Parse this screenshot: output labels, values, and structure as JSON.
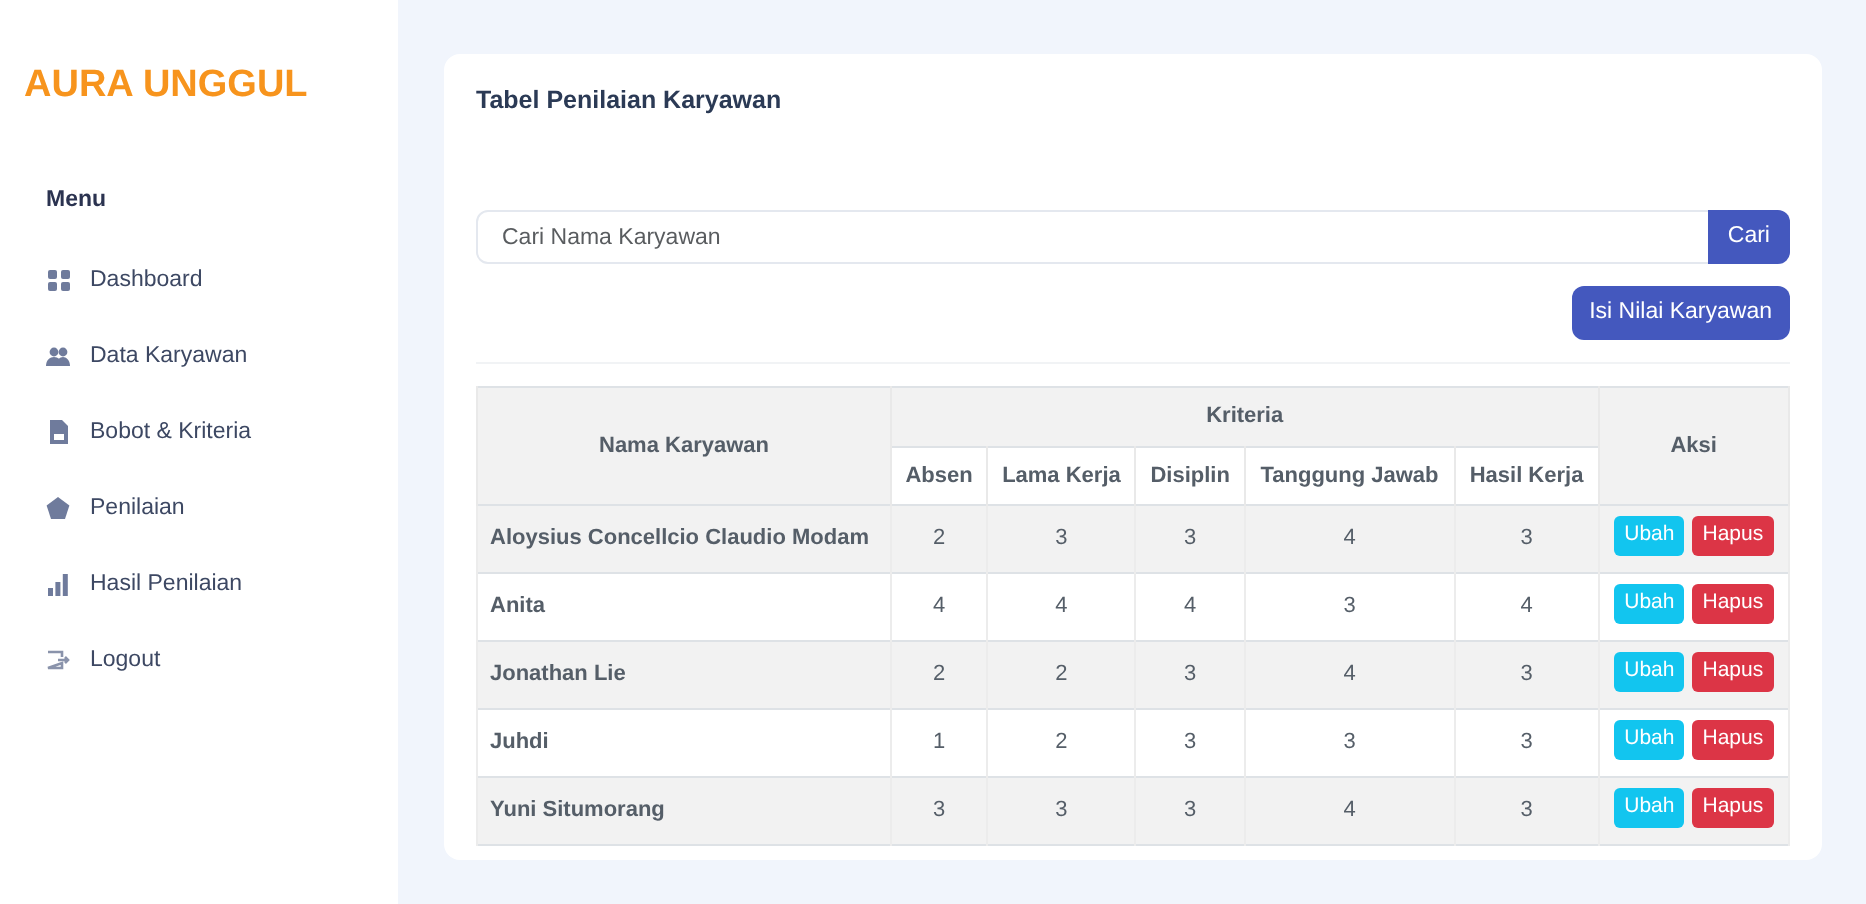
{
  "brand": "AURA UNGGUL",
  "menu": {
    "heading": "Menu",
    "items": [
      {
        "label": "Dashboard"
      },
      {
        "label": "Data Karyawan"
      },
      {
        "label": "Bobot & Kriteria"
      },
      {
        "label": "Penilaian"
      },
      {
        "label": "Hasil Penilaian"
      },
      {
        "label": "Logout"
      }
    ]
  },
  "card": {
    "title": "Tabel Penilaian Karyawan",
    "search": {
      "placeholder": "Cari Nama Karyawan",
      "button": "Cari"
    },
    "add_button": "Isi Nilai Karyawan",
    "table": {
      "name_column": "Nama Karyawan",
      "group_column": "Kriteria",
      "criteria": [
        "Absen",
        "Lama Kerja",
        "Disiplin",
        "Tanggung Jawab",
        "Hasil Kerja"
      ],
      "action_column": "Aksi",
      "rows": [
        {
          "name": "Aloysius Concellcio Claudio Modam",
          "scores": [
            "2",
            "3",
            "3",
            "4",
            "3"
          ],
          "actions": [
            "Ubah",
            "Hapus"
          ]
        },
        {
          "name": "Anita",
          "scores": [
            "4",
            "4",
            "4",
            "3",
            "4"
          ],
          "actions": [
            "Ubah",
            "Hapus"
          ]
        },
        {
          "name": "Jonathan Lie",
          "scores": [
            "2",
            "2",
            "3",
            "4",
            "3"
          ],
          "actions": [
            "Ubah",
            "Hapus"
          ]
        },
        {
          "name": "Juhdi",
          "scores": [
            "1",
            "2",
            "3",
            "3",
            "3"
          ],
          "actions": [
            "Ubah",
            "Hapus"
          ]
        },
        {
          "name": "Yuni Situmorang",
          "scores": [
            "3",
            "3",
            "3",
            "4",
            "3"
          ],
          "actions": [
            "Ubah",
            "Hapus"
          ]
        }
      ]
    }
  }
}
